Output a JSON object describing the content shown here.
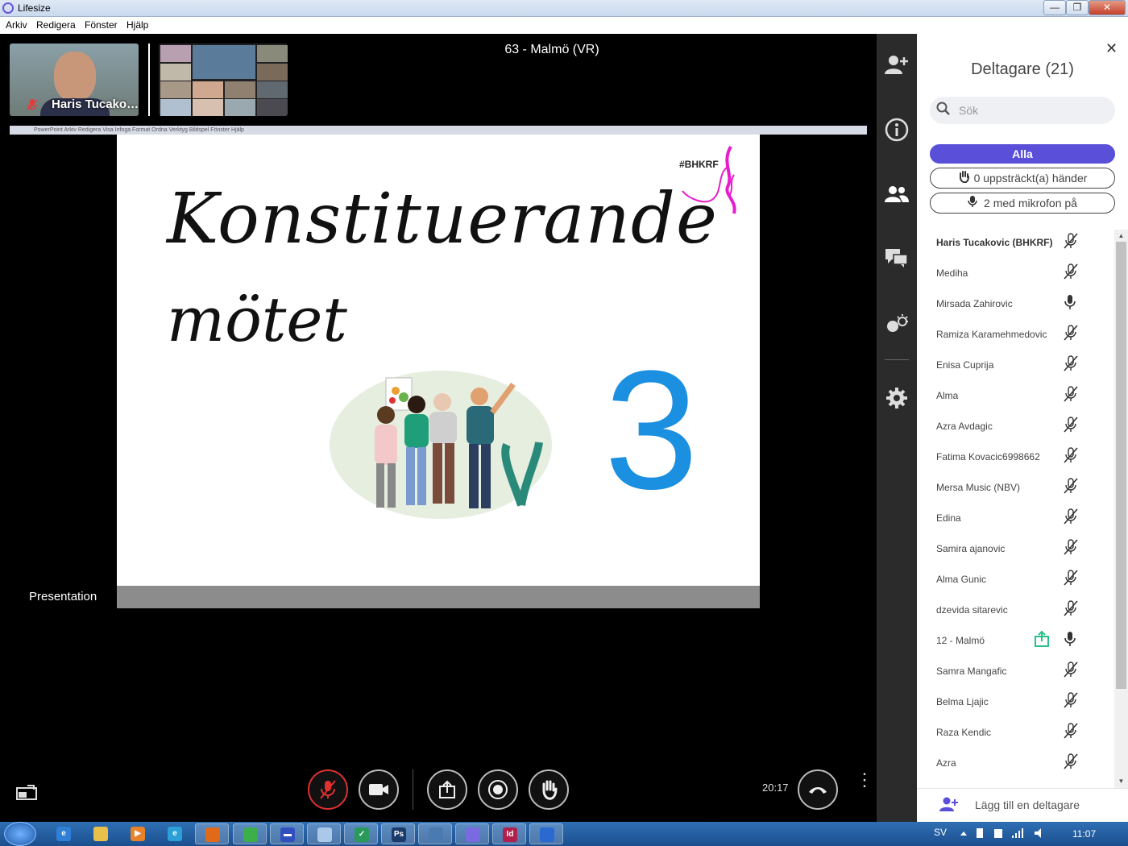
{
  "window": {
    "title": "Lifesize",
    "minimize": "—",
    "maximize": "❐",
    "close": "✕"
  },
  "menu": [
    "Arkiv",
    "Redigera",
    "Fönster",
    "Hjälp"
  ],
  "meeting": {
    "title": "63 - Malmö (VR)",
    "self_name": "Haris Tucako…",
    "presentation_label": "Presentation"
  },
  "shared_screen": {
    "menubar_text": "PowerPoint   Arkiv   Redigera   Visa   Infoga   Format   Ordna   Verktyg   Bildspel   Fönster   Hjälp",
    "slide": {
      "title_line1": "Konstituerande",
      "title_line2": "mötet",
      "hashtag": "#BHKRF",
      "number": "3"
    }
  },
  "controls": {
    "time": "20:17"
  },
  "participants_panel": {
    "title": "Deltagare (21)",
    "search_placeholder": "Sök",
    "filters": {
      "all": "Alla",
      "raised_hands": "0 uppsträckt(a) händer",
      "mics_on": "2 med mikrofon på"
    },
    "participants": [
      {
        "name": "Haris Tucakovic (BHKRF)",
        "bold": true,
        "mic": "muted",
        "sharing": false
      },
      {
        "name": "Mediha",
        "bold": false,
        "mic": "muted",
        "sharing": false
      },
      {
        "name": "Mirsada Zahirovic",
        "bold": false,
        "mic": "on",
        "sharing": false
      },
      {
        "name": "Ramiza Karamehmedovic",
        "bold": false,
        "mic": "muted",
        "sharing": false
      },
      {
        "name": "Enisa Cuprija",
        "bold": false,
        "mic": "muted",
        "sharing": false
      },
      {
        "name": "Alma",
        "bold": false,
        "mic": "muted",
        "sharing": false
      },
      {
        "name": "Azra Avdagic",
        "bold": false,
        "mic": "muted",
        "sharing": false
      },
      {
        "name": "Fatima Kovacic6998662",
        "bold": false,
        "mic": "muted",
        "sharing": false
      },
      {
        "name": "Mersa Music (NBV)",
        "bold": false,
        "mic": "muted",
        "sharing": false
      },
      {
        "name": "Edina",
        "bold": false,
        "mic": "muted",
        "sharing": false
      },
      {
        "name": "Samira ajanovic",
        "bold": false,
        "mic": "muted",
        "sharing": false
      },
      {
        "name": "Alma Gunic",
        "bold": false,
        "mic": "muted",
        "sharing": false
      },
      {
        "name": "dzevida sitarevic",
        "bold": false,
        "mic": "muted",
        "sharing": false
      },
      {
        "name": "12 - Malmö",
        "bold": false,
        "mic": "on",
        "sharing": true
      },
      {
        "name": "Samra Mangafic",
        "bold": false,
        "mic": "muted",
        "sharing": false
      },
      {
        "name": "Belma Ljajic",
        "bold": false,
        "mic": "muted",
        "sharing": false
      },
      {
        "name": "Raza Kendic",
        "bold": false,
        "mic": "muted",
        "sharing": false
      },
      {
        "name": "Azra",
        "bold": false,
        "mic": "muted",
        "sharing": false
      }
    ],
    "add_participant": "Lägg till en deltagare"
  },
  "taskbar": {
    "language": "SV",
    "clock": "11:07",
    "apps": [
      "ie-icon",
      "explorer-icon",
      "media-player-icon",
      "edge-icon",
      "firefox-icon",
      "chrome-icon",
      "save-icon",
      "notepad-icon",
      "security-icon",
      "photoshop-icon",
      "window-icon",
      "lifesize-icon",
      "indesign-icon",
      "outlook-icon"
    ]
  },
  "colors": {
    "accent": "#5a4fd8",
    "muted_red": "#e03030",
    "slide_number_blue": "#1b8fe0",
    "share_green": "#2bbf8a"
  }
}
